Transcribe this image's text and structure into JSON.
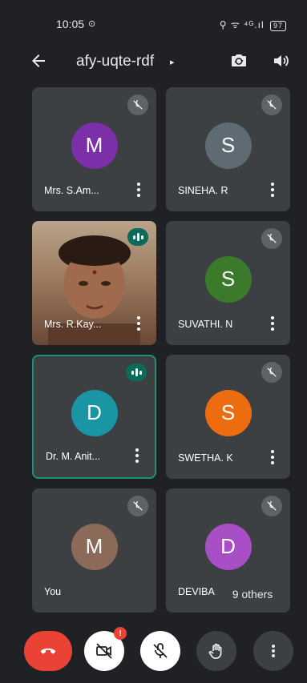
{
  "status_bar": {
    "time": "10:05",
    "cast_symbol": "⊙",
    "signal_text": "⚲ ᯤ ⁴ᴳ.ıl",
    "battery": "97"
  },
  "toolbar": {
    "meeting_code": "afy-uqte-rdf",
    "caret": "▸"
  },
  "tiles": [
    {
      "name": "Mrs. S.Am...",
      "initial": "M",
      "avatar_color": "#7b2fa8",
      "mic": "muted"
    },
    {
      "name": "SINEHA. R",
      "initial": "S",
      "avatar_color": "#5f6b73",
      "mic": "muted"
    },
    {
      "name": "Mrs. R.Kay...",
      "initial": "",
      "avatar_color": "",
      "mic": "speaking",
      "video": true
    },
    {
      "name": "SUVATHI. N",
      "initial": "S",
      "avatar_color": "#3b7a2a",
      "mic": "muted"
    },
    {
      "name": "Dr. M. Anit...",
      "initial": "D",
      "avatar_color": "#1a95a3",
      "mic": "speaking"
    },
    {
      "name": "SWETHA. K",
      "initial": "S",
      "avatar_color": "#ee6c10",
      "mic": "muted"
    },
    {
      "name": "You",
      "initial": "M",
      "avatar_color": "#8b6a5a",
      "mic": "muted"
    },
    {
      "name": "DEVIBA",
      "initial": "D",
      "avatar_color": "#a84fc6",
      "mic": "muted"
    }
  ],
  "others_pill": "9 others",
  "call_controls": {
    "camera_alert": "!"
  },
  "colors": {
    "background": "#202124",
    "tile": "#3c4043",
    "end_call": "#ea4335",
    "active_border": "#1e8e7e"
  }
}
